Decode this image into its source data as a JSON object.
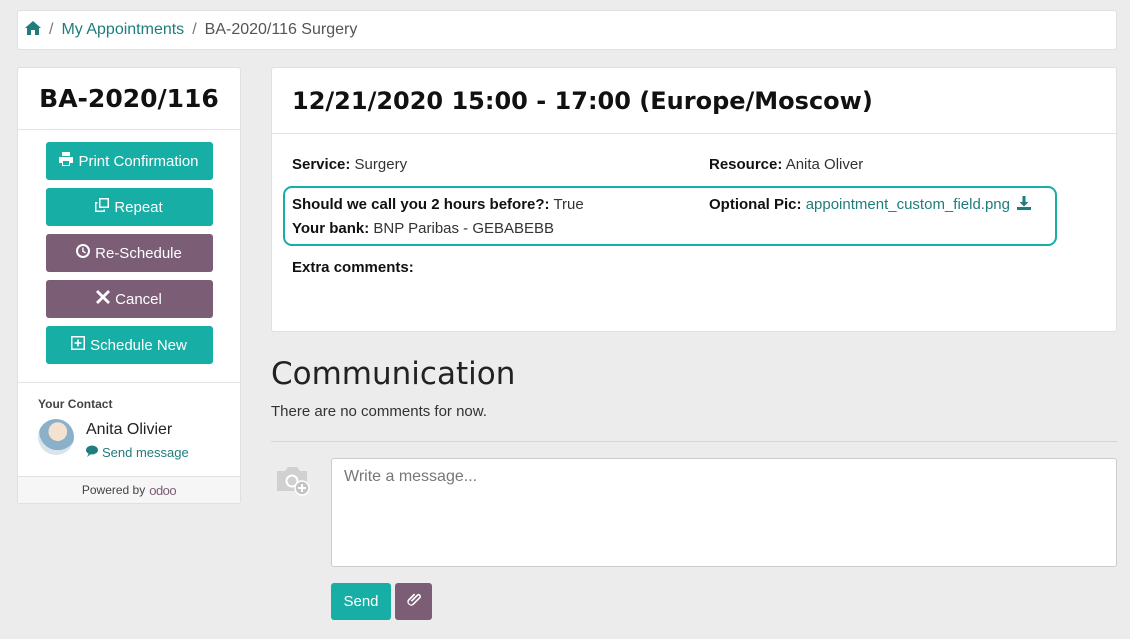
{
  "breadcrumb": {
    "home_icon": "home-icon",
    "sep1": "/",
    "link": "My Appointments",
    "sep2": "/",
    "current": "BA-2020/116 Surgery"
  },
  "sidebar": {
    "reference": "BA-2020/116",
    "buttons": [
      {
        "label": "Print Confirmation",
        "icon": "print-icon",
        "color": "#17aea6"
      },
      {
        "label": "Repeat",
        "icon": "copy-icon",
        "color": "#17aea6"
      },
      {
        "label": "Re-Schedule",
        "icon": "clock-icon",
        "color": "#7b5d75"
      },
      {
        "label": "Cancel",
        "icon": "close-icon",
        "color": "#7b5d75"
      },
      {
        "label": "Schedule New",
        "icon": "plus-square-icon",
        "color": "#17aea6"
      }
    ],
    "contact": {
      "label": "Your Contact",
      "name": "Anita Olivier",
      "send_message": "Send message"
    },
    "powered_by": "Powered by",
    "powered_logo": "odoo"
  },
  "appointment": {
    "heading": "12/21/2020 15:00 - 17:00 (Europe/Moscow)",
    "service_label": "Service:",
    "service_value": "Surgery",
    "resource_label": "Resource:",
    "resource_value": "Anita Oliver",
    "call_label": "Should we call you 2 hours before?:",
    "call_value": "True",
    "bank_label": "Your bank:",
    "bank_value": "BNP Paribas - GEBABEBB",
    "pic_label": "Optional Pic:",
    "pic_value": "appointment_custom_field.png",
    "extra_label": "Extra comments:"
  },
  "communication": {
    "title": "Communication",
    "empty": "There are no comments for now.",
    "placeholder": "Write a message...",
    "send_label": "Send"
  },
  "colors": {
    "accent": "#17aea6",
    "secondary": "#7b5d75",
    "link": "#1f7d7d"
  }
}
